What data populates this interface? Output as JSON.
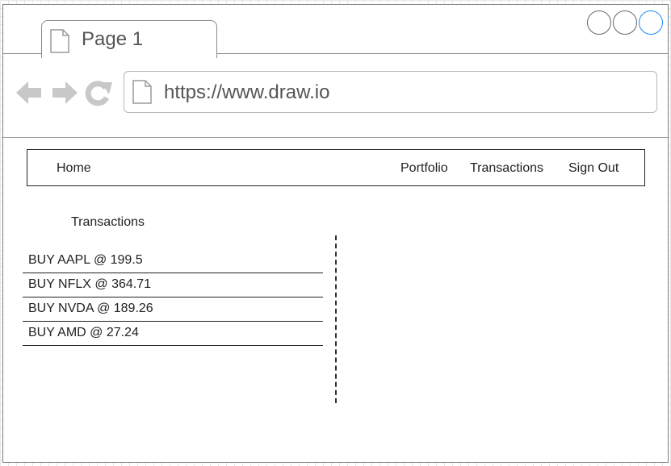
{
  "browser": {
    "tab_title": "Page 1",
    "url": "https://www.draw.io",
    "accent_color": "#1a8cff"
  },
  "nav": {
    "home": "Home",
    "portfolio": "Portfolio",
    "transactions": "Transactions",
    "sign_out": "Sign Out"
  },
  "main": {
    "section_title": "Transactions",
    "transactions": [
      "BUY AAPL @ 199.5",
      "BUY NFLX @ 364.71",
      "BUY NVDA @ 189.26",
      "BUY AMD @ 27.24"
    ]
  }
}
